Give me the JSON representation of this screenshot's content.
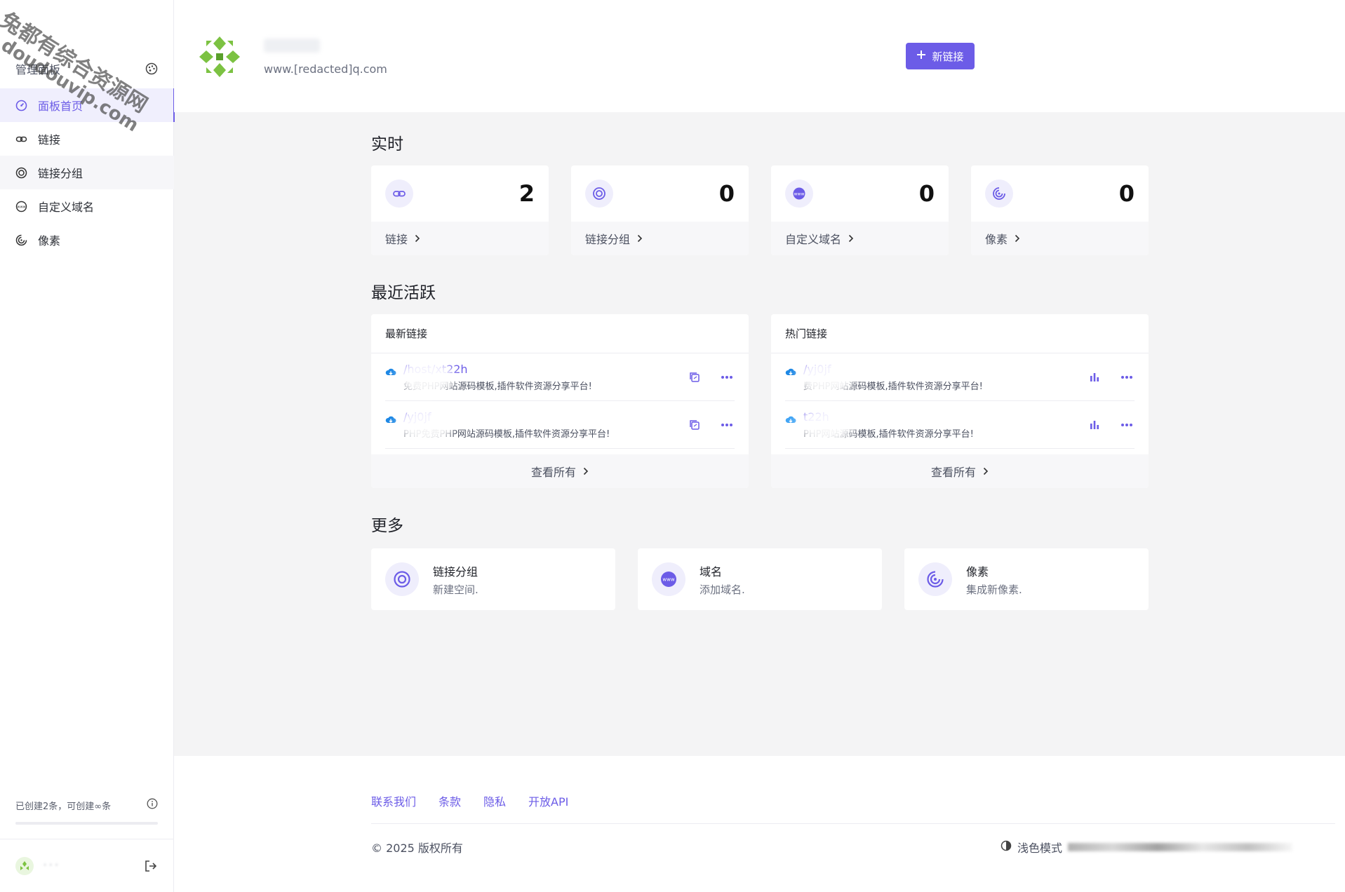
{
  "watermark": {
    "line1": "兔都有综合资源网",
    "line2": "doudouvip.com"
  },
  "sidebar": {
    "title": "管理面板",
    "items": [
      {
        "label": "面板首页",
        "icon": "dashboard-icon",
        "active": true
      },
      {
        "label": "链接",
        "icon": "link-icon"
      },
      {
        "label": "链接分组",
        "icon": "target-icon"
      },
      {
        "label": "自定义域名",
        "icon": "www-icon"
      },
      {
        "label": "像素",
        "icon": "pixel-icon"
      }
    ],
    "quota_text": "已创建2条，可创建∞条"
  },
  "header": {
    "domain": "www.[redacted]q.com",
    "new_link_label": "新链接"
  },
  "realtime": {
    "title": "实时",
    "cards": [
      {
        "value": "2",
        "label": "链接",
        "icon": "link-icon"
      },
      {
        "value": "0",
        "label": "链接分组",
        "icon": "target-icon"
      },
      {
        "value": "0",
        "label": "自定义域名",
        "icon": "www-icon"
      },
      {
        "value": "0",
        "label": "像素",
        "icon": "pixel-icon"
      }
    ]
  },
  "recent": {
    "title": "最近活跃",
    "latest": {
      "title": "最新链接",
      "rows": [
        {
          "url": "/host/xt22h",
          "desc": "免费PHP网站源码模板,插件软件资源分享平台!"
        },
        {
          "url": "/yj0jf",
          "desc": "PHP免费PHP网站源码模板,插件软件资源分享平台!"
        }
      ],
      "view_all": "查看所有"
    },
    "popular": {
      "title": "热门链接",
      "rows": [
        {
          "url": "/yj0jf",
          "desc": "费PHP网站源码模板,插件软件资源分享平台!"
        },
        {
          "url": "t22h",
          "desc": "PHP网站源码模板,插件软件资源分享平台!"
        }
      ],
      "view_all": "查看所有"
    }
  },
  "more": {
    "title": "更多",
    "cards": [
      {
        "title": "链接分组",
        "sub": "新建空间.",
        "icon": "target-icon"
      },
      {
        "title": "域名",
        "sub": "添加域名.",
        "icon": "www-icon"
      },
      {
        "title": "像素",
        "sub": "集成新像素.",
        "icon": "pixel-icon"
      }
    ]
  },
  "footer": {
    "links": [
      "联系我们",
      "条款",
      "隐私",
      "开放API"
    ],
    "copyright": "© 2025 版权所有",
    "theme_label": "浅色模式"
  },
  "colors": {
    "accent": "#6c5ce7",
    "bg": "#f4f4f5"
  }
}
